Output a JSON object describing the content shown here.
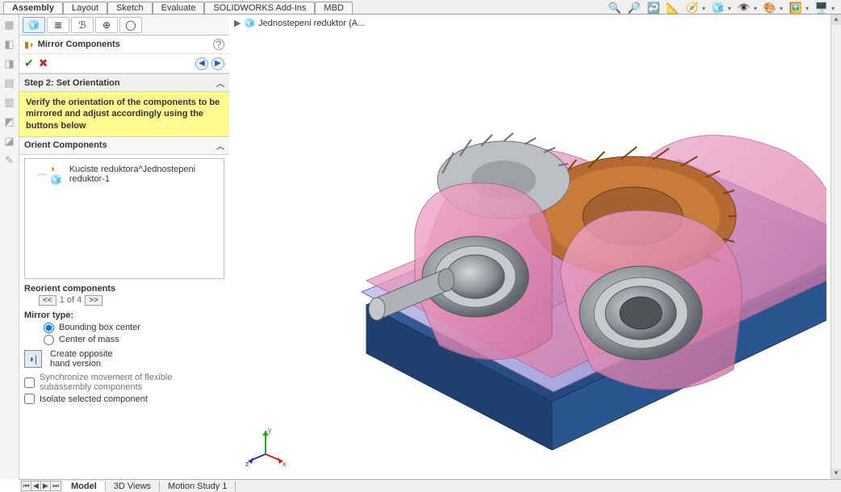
{
  "top_tabs": {
    "items": [
      "Assembly",
      "Layout",
      "Sketch",
      "Evaluate",
      "SOLIDWORKS Add-Ins",
      "MBD"
    ],
    "active": 0
  },
  "breadcrumb": {
    "label": "Jednostepeni reduktor  (A..."
  },
  "pm": {
    "title": "Mirror Components",
    "step_header": "Step 2: Set Orientation",
    "step_help": "Verify the orientation of the components to be mirrored and adjust accordingly using the buttons below",
    "orient_header": "Orient Components",
    "tree_item": "Kuciste reduktora^Jednostepeni reduktor-1",
    "reorient_label": "Reorient components",
    "pager": {
      "prev": "<<",
      "text": "1 of 4",
      "next": ">>"
    },
    "mirror_type_label": "Mirror type:",
    "mirror_type": {
      "o1": "Bounding box center",
      "o2": "Center of mass"
    },
    "create_opposite": "Create opposite\nhand version",
    "sync_label": "Synchronize movement of flexible subassembly components",
    "isolate_label": "Isolate selected component"
  },
  "bottom_tabs": {
    "items": [
      "Model",
      "3D Views",
      "Motion Study 1"
    ],
    "active": 0
  },
  "triad": {
    "x": "x",
    "y": "y",
    "z": "z"
  },
  "colors": {
    "housing_pink": "#e98db5",
    "housing_edge": "#9b6fb0",
    "base_blue": "#2d5e9b",
    "base_blue_light": "#4a7ec2",
    "flange_lav": "#a8a0d8",
    "steel": "#9fa4a9",
    "steel_dark": "#6f7478",
    "gear_amber": "#c97c3a"
  }
}
